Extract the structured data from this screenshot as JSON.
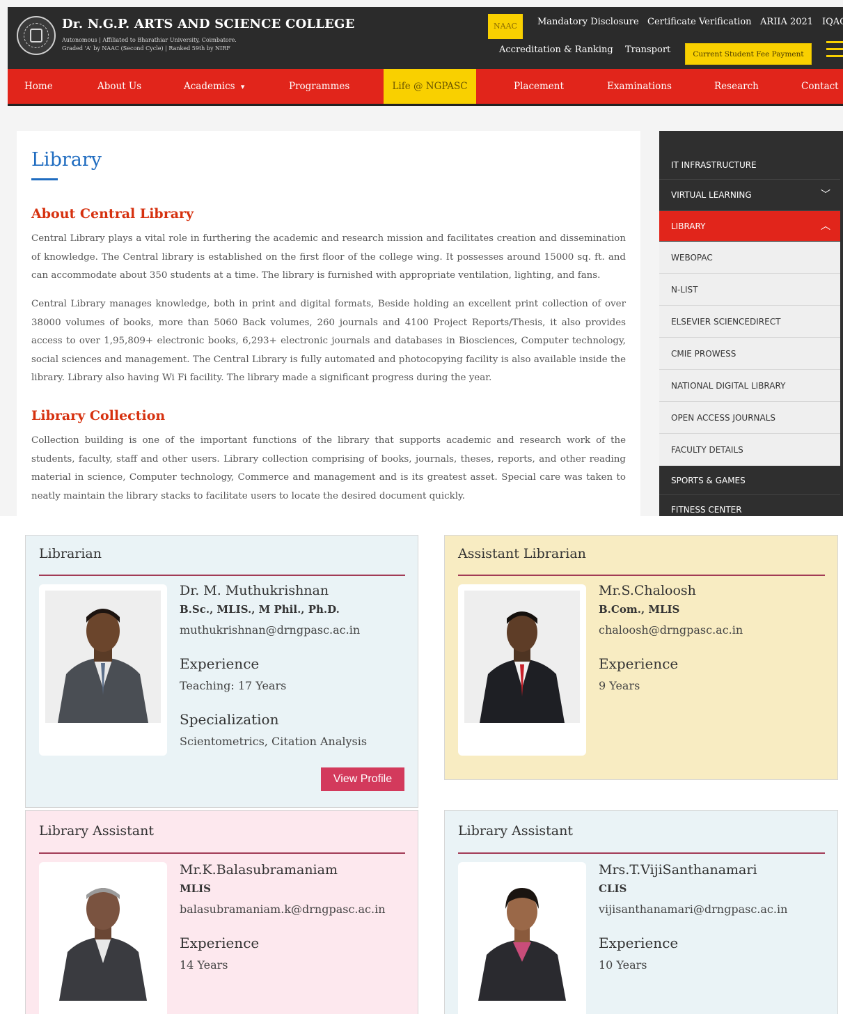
{
  "header": {
    "college_name": "Dr. N.G.P. ARTS AND SCIENCE COLLEGE",
    "subtitle_line1": "Autonomous | Affiliated to Bharathiar University, Coimbatore.",
    "subtitle_line2": "Graded 'A' by NAAC (Second Cycle) | Ranked 59th by NIRF",
    "naac_label": "NAAC",
    "links_row1": [
      "Mandatory Disclosure",
      "Certificate Verification",
      "ARIIA 2021",
      "IQAC"
    ],
    "links_row2": [
      "Accreditation & Ranking",
      "Transport"
    ],
    "fee_button": "Current Student Fee Payment"
  },
  "nav": {
    "items": [
      "Home",
      "About Us",
      "Academics",
      "Programmes",
      "Life @ NGPASC",
      "Placement",
      "Examinations",
      "Research",
      "Contact"
    ],
    "academics_caret": "▾",
    "active": "Life @ NGPASC"
  },
  "main": {
    "title": "Library",
    "about_heading": "About Central Library",
    "about_para1": "Central Library plays a vital role in furthering the academic and research mission and facilitates creation and dissemination of knowledge. The Central library is established on the first floor of the college wing. It possesses around 15000 sq. ft. and can accommodate about 350 students at a time. The library is furnished with appropriate ventilation, lighting, and fans.",
    "about_para2": "Central Library manages knowledge, both in print and digital formats, Beside holding an excellent print collection of over 38000 volumes of books, more than 5060 Back volumes, 260 journals and 4100 Project Reports/Thesis, it also provides access to over 1,95,809+ electronic books, 6,293+ electronic journals and databases in Biosciences, Computer technology, social sciences and management. The Central Library is fully automated and photocopying facility is also available inside the library. Library also having Wi Fi facility. The library made a significant progress during the year.",
    "collection_heading": "Library Collection",
    "collection_para": "Collection building is one of the important functions of the library that supports academic and research work of the students, faculty, staff and other users. Library collection comprising of books, journals, theses, reports, and other reading material in science, Computer technology, Commerce and management and is its greatest asset. Special care was taken to neatly maintain the library stacks to facilitate users to locate the desired document quickly."
  },
  "sidebar": {
    "items": [
      {
        "label": "IT INFRASTRUCTURE",
        "chevron": ""
      },
      {
        "label": "VIRTUAL LEARNING",
        "chevron": "﹀"
      },
      {
        "label": "LIBRARY",
        "chevron": "︿"
      },
      {
        "label": "WEBOPAC",
        "chevron": ""
      },
      {
        "label": "N-LIST",
        "chevron": ""
      },
      {
        "label": "ELSEVIER SCIENCEDIRECT",
        "chevron": ""
      },
      {
        "label": "CMIE PROWESS",
        "chevron": ""
      },
      {
        "label": "NATIONAL DIGITAL LIBRARY",
        "chevron": ""
      },
      {
        "label": "OPEN ACCESS JOURNALS",
        "chevron": ""
      },
      {
        "label": "FACULTY DETAILS",
        "chevron": ""
      },
      {
        "label": "SPORTS & GAMES",
        "chevron": ""
      },
      {
        "label": "FITNESS CENTER",
        "chevron": ""
      }
    ]
  },
  "staff": [
    {
      "role": "Librarian",
      "name": "Dr. M. Muthukrishnan",
      "qualification": "B.Sc., MLIS., M Phil., Ph.D.",
      "email": "muthukrishnan@drngpasc.ac.in",
      "experience_heading": "Experience",
      "experience": "Teaching: 17 Years",
      "specialization_heading": "Specialization",
      "specialization": "Scientometrics, Citation Analysis",
      "button": "View Profile",
      "bg_color": "#eaf3f6"
    },
    {
      "role": "Assistant Librarian",
      "name": "Mr.S.Chaloosh",
      "qualification": "B.Com., MLIS",
      "email": "chaloosh@drngpasc.ac.in",
      "experience_heading": "Experience",
      "experience": "9 Years",
      "bg_color": "#f8ecc2"
    },
    {
      "role": "Library Assistant",
      "name": "Mr.K.Balasubramaniam",
      "qualification": "MLIS",
      "email": "balasubramaniam.k@drngpasc.ac.in",
      "experience_heading": "Experience",
      "experience": "14 Years",
      "bg_color": "#fde8ee"
    },
    {
      "role": "Library Assistant",
      "name": "Mrs.T.VijiSanthanamari",
      "qualification": "CLIS",
      "email": "vijisanthanamari@drngpasc.ac.in",
      "experience_heading": "Experience",
      "experience": "10 Years",
      "bg_color": "#eaf3f6"
    }
  ],
  "colors": {
    "nav_red": "#e1251b",
    "accent_yellow": "#f9d000",
    "title_blue": "#1f6cc0",
    "heading_orange": "#d6310f",
    "button_pink": "#d33a5c"
  }
}
